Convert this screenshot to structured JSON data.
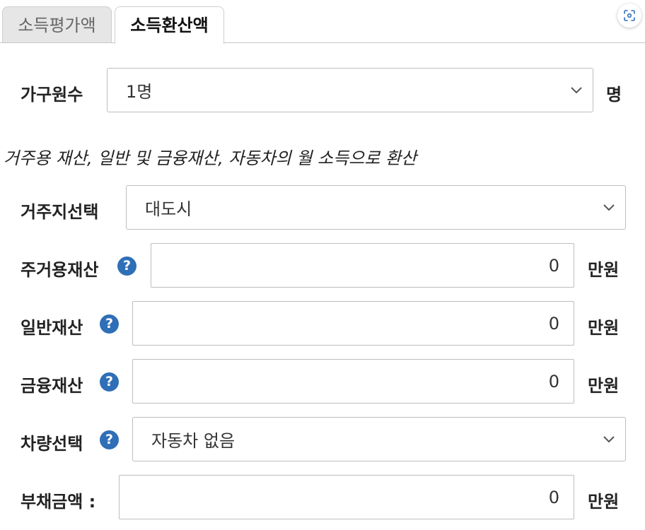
{
  "tabs": [
    {
      "label": "소득평가액",
      "active": false
    },
    {
      "label": "소득환산액",
      "active": true
    }
  ],
  "scan_button": {
    "icon": "scan-icon"
  },
  "household": {
    "label": "가구원수",
    "value": "1명",
    "unit": "명"
  },
  "section_note": "거주용 재산, 일반 및 금융재산, 자동차의 월 소득으로 환산",
  "residence": {
    "label": "거주지선택",
    "value": "대도시"
  },
  "housing_asset": {
    "label": "주거용재산",
    "value": "0",
    "unit": "만원",
    "help_icon": "question-circle-icon"
  },
  "general_asset": {
    "label": "일반재산",
    "value": "0",
    "unit": "만원",
    "help_icon": "question-circle-icon"
  },
  "financial_asset": {
    "label": "금융재산",
    "value": "0",
    "unit": "만원",
    "help_icon": "question-circle-icon"
  },
  "vehicle": {
    "label": "차량선택",
    "value": "자동차 없음",
    "help_icon": "question-circle-icon"
  },
  "debt": {
    "label": "부채금액 :",
    "value": "0",
    "unit": "만원"
  },
  "colors": {
    "help_blue": "#2f6fb7",
    "tab_inactive_bg": "#e6e6e6",
    "border": "#bdbdbd"
  }
}
